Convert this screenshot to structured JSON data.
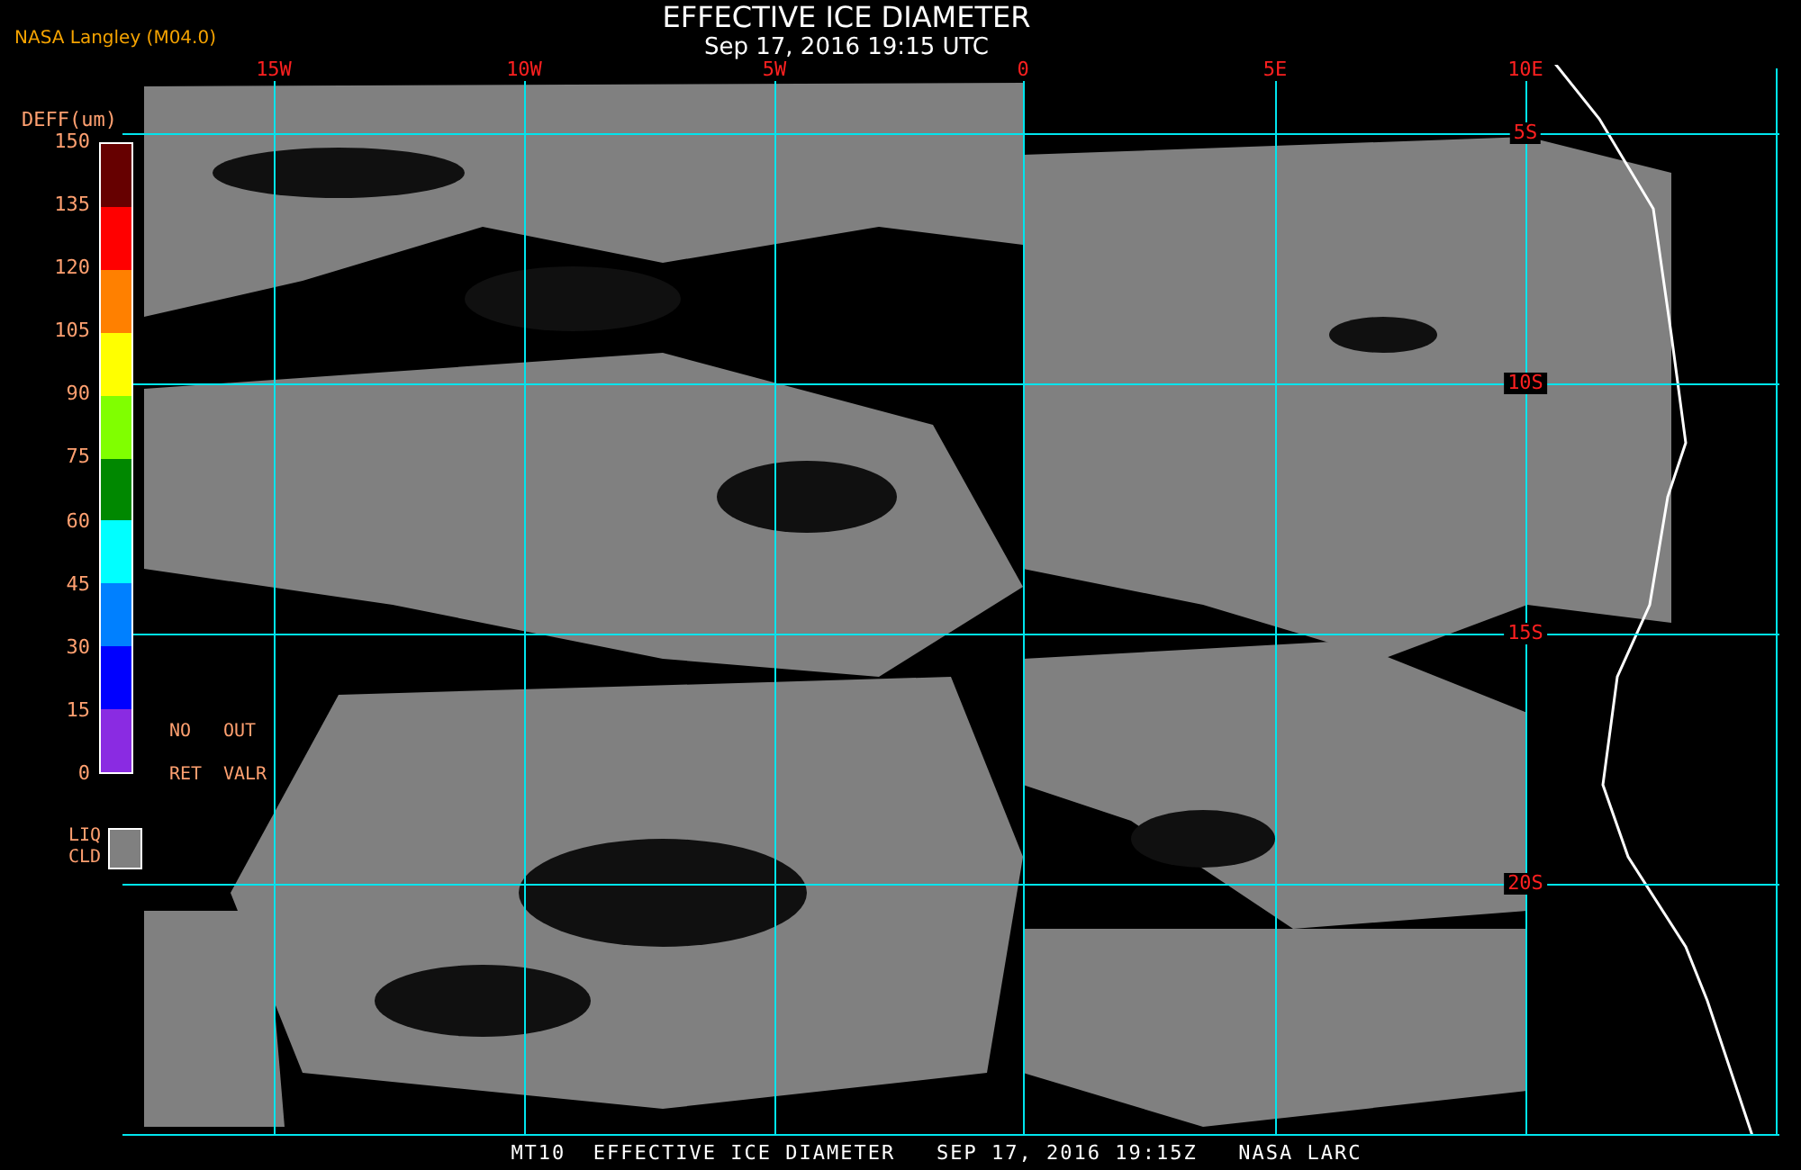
{
  "header": {
    "source": "NASA Langley (M04.0)",
    "title": "EFFECTIVE ICE DIAMETER",
    "timestamp": "Sep 17, 2016 19:15 UTC"
  },
  "map": {
    "lon_labels": [
      "15W",
      "10W",
      "5W",
      "0",
      "5E",
      "10E"
    ],
    "lat_labels": [
      "5S",
      "10S",
      "15S",
      "20S"
    ]
  },
  "legend": {
    "unit": "DEFF(um)",
    "ticks": [
      "150",
      "135",
      "120",
      "105",
      "90",
      "75",
      "60",
      "45",
      "30",
      "15",
      "0"
    ],
    "bins": [
      {
        "color": "#660000"
      },
      {
        "color": "#ff0000"
      },
      {
        "color": "#ff8000"
      },
      {
        "color": "#ffff00"
      },
      {
        "color": "#80ff00"
      },
      {
        "color": "#008800"
      },
      {
        "color": "#00ffff"
      },
      {
        "color": "#0080ff"
      },
      {
        "color": "#0000ff"
      },
      {
        "color": "#8a2be2"
      }
    ],
    "notes": [
      "NO",
      "OUT",
      "RET",
      "VALR"
    ],
    "liquid": {
      "label": "LIQ CLD",
      "color": "#808080"
    }
  },
  "footer": "MT10  EFFECTIVE ICE DIAMETER   SEP 17, 2016 19:15Z   NASA LARC"
}
